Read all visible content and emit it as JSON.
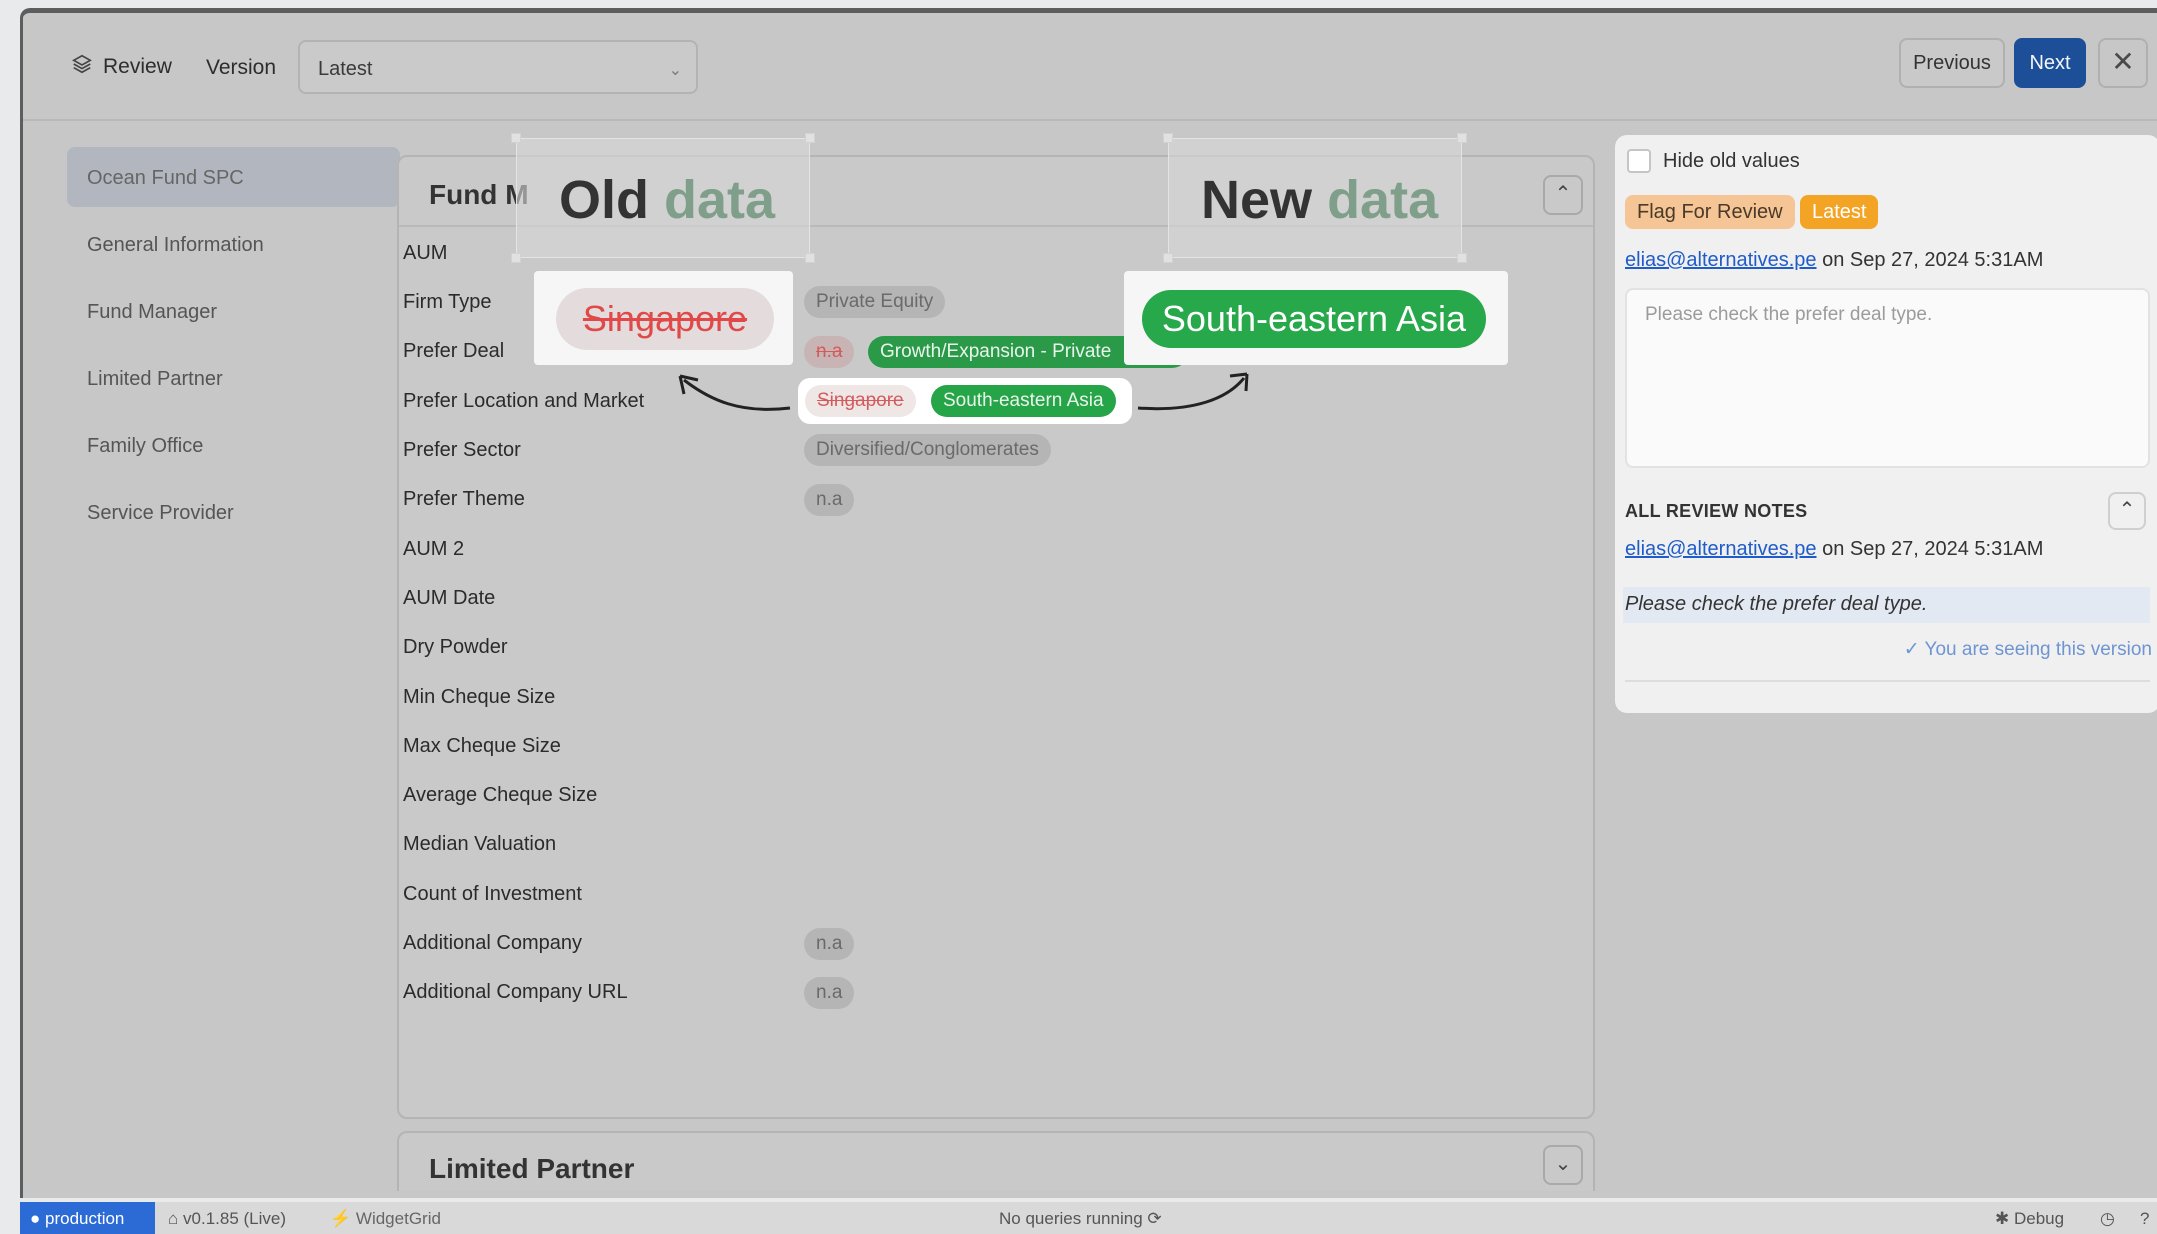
{
  "topbar": {
    "review_label": "Review",
    "version_label": "Version",
    "version_select_value": "Latest",
    "previous_label": "Previous",
    "next_label": "Next",
    "close_icon": "close-icon",
    "accent_color": "#1d4f98"
  },
  "sidebar": {
    "items": [
      {
        "label": "Ocean Fund SPC",
        "active": true
      },
      {
        "label": "General Information"
      },
      {
        "label": "Fund Manager"
      },
      {
        "label": "Limited Partner"
      },
      {
        "label": "Family Office"
      },
      {
        "label": "Service Provider"
      }
    ]
  },
  "section": {
    "title": "Fund M",
    "rows": [
      {
        "label": "AUM"
      },
      {
        "label": "Firm Type",
        "chips": [
          "Private Equity"
        ]
      },
      {
        "label": "Prefer Deal",
        "old": "n.a",
        "new": "Growth/Expansion - Private"
      },
      {
        "label": "Prefer Location and Market",
        "old": "Singapore",
        "new": "South-eastern Asia"
      },
      {
        "label": "Prefer Sector",
        "chips": [
          "Diversified/Conglomerates"
        ]
      },
      {
        "label": "Prefer Theme",
        "chips": [
          "n.a"
        ]
      },
      {
        "label": "AUM 2"
      },
      {
        "label": "AUM Date"
      },
      {
        "label": "Dry Powder"
      },
      {
        "label": "Min Cheque Size"
      },
      {
        "label": "Max Cheque Size"
      },
      {
        "label": "Average Cheque Size"
      },
      {
        "label": "Median Valuation"
      },
      {
        "label": "Count of Investment"
      },
      {
        "label": "Additional Company",
        "chips": [
          "n.a"
        ]
      },
      {
        "label": "Additional Company URL",
        "chips": [
          "n.a"
        ]
      }
    ]
  },
  "section2": {
    "title": "Limited Partner"
  },
  "overlay": {
    "old_title_w1": "Old",
    "old_title_w2": "data",
    "new_title_w1": "New",
    "new_title_w2": "data",
    "old_value": "Singapore",
    "new_value": "South-eastern Asia"
  },
  "review_panel": {
    "hide_old_label": "Hide old values",
    "flag_badge": "Flag For Review",
    "latest_badge": "Latest",
    "author_email": "elias@alternatives.pe",
    "author_date": "on Sep 27, 2024 5:31AM",
    "note_text": "Please check the prefer deal type.",
    "notes_heading": "ALL REVIEW NOTES",
    "note_author_email": "elias@alternatives.pe",
    "note_author_date": "on Sep 27, 2024 5:31AM",
    "note_body": "Please check the prefer deal type.",
    "seeing_version": "✓ You are seeing this version"
  },
  "statusbar": {
    "env": "production",
    "version": "v0.1.85 (Live)",
    "widget": "WidgetGrid",
    "queries": "No queries running",
    "debug": "Debug"
  }
}
